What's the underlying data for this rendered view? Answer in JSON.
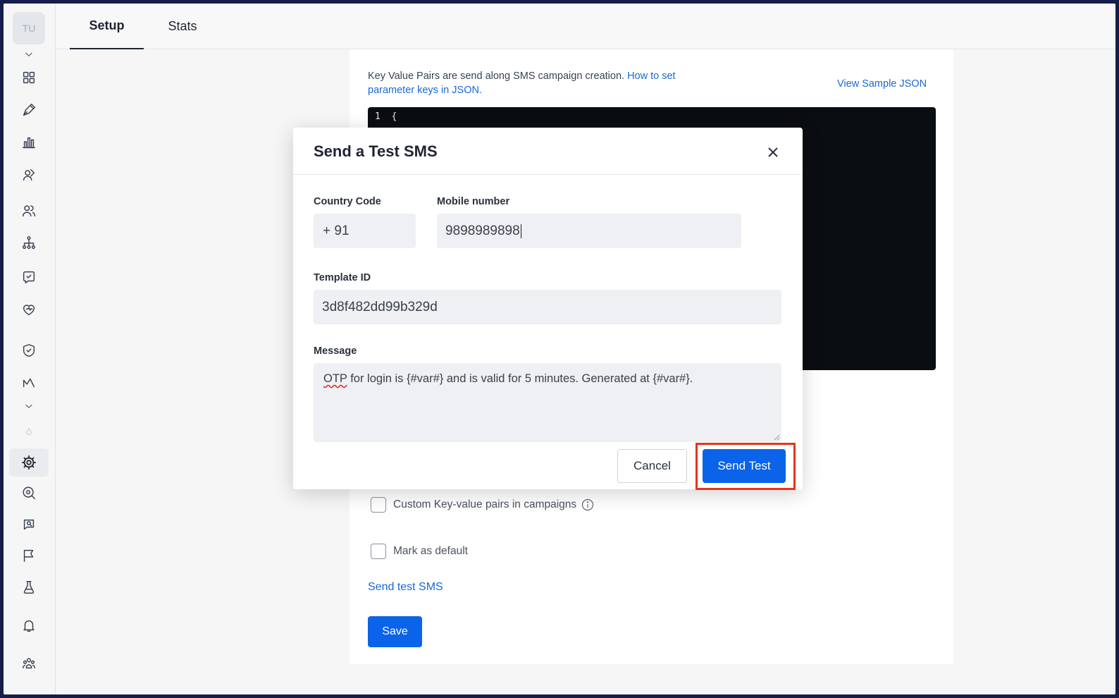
{
  "sidebar": {
    "avatar_initials": "TU",
    "icons": [
      "chevron-down-icon",
      "dashboard-grid-icon",
      "pen-nib-icon",
      "bar-chart-icon",
      "user-journey-icon",
      "users-icon",
      "hierarchy-icon",
      "chat-bot-icon",
      "heart-hand-icon",
      "shield-icon",
      "analytics-icon",
      "chevron-down-icon",
      "drop-icon",
      "gear-icon",
      "search-circle-icon",
      "search-chat-icon",
      "comment-flag-icon",
      "flask-icon",
      "bell-icon",
      "team-icon"
    ],
    "active": "gear-icon"
  },
  "tabs": [
    {
      "label": "Setup",
      "active": true
    },
    {
      "label": "Stats",
      "active": false
    }
  ],
  "card": {
    "kv_text": "Key Value Pairs are send along SMS campaign creation. ",
    "kv_link": "How to set parameter keys in JSON",
    "kv_link_end": ".",
    "view_sample_json": "View Sample JSON",
    "code_line": "1  {",
    "checkbox_custom_kv": "Custom Key-value pairs in campaigns",
    "checkbox_default": "Mark as default",
    "send_test_link": "Send test SMS",
    "save_label": "Save"
  },
  "modal": {
    "title": "Send a Test SMS",
    "country_code_label": "Country Code",
    "country_code_value": "+ 91",
    "mobile_label": "Mobile number",
    "mobile_value": "9898989898",
    "template_label": "Template ID",
    "template_value": "3d8f482dd99b329d",
    "message_label": "Message",
    "message_first_word": "OTP",
    "message_rest": " for login is {#var#} and is valid for 5 minutes. Generated at {#var#}.",
    "cancel_label": "Cancel",
    "send_label": "Send Test"
  },
  "colors": {
    "primary": "#0b63ea",
    "link": "#1769d6",
    "highlight": "#e8331f",
    "frame": "#151e4a"
  }
}
